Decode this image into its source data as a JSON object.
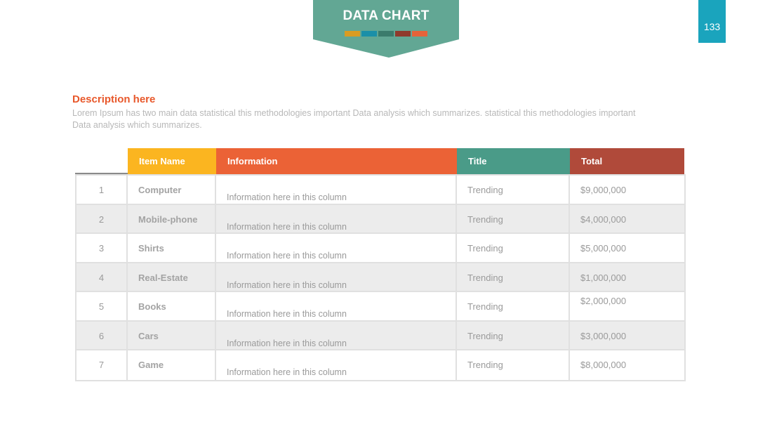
{
  "header": {
    "title": "DATA CHART",
    "ribbon_color": "#62a794",
    "swatch_colors": [
      "#d99c22",
      "#1b8fa8",
      "#3b7b6c",
      "#8f3a2c",
      "#e5633a"
    ]
  },
  "page_number": "133",
  "description": {
    "heading": "Description here",
    "text": "Lorem Ipsum has two main data statistical this methodologies important Data analysis which summarizes. statistical this methodologies important Data analysis which summarizes."
  },
  "table": {
    "columns": [
      {
        "label": "Item Name",
        "color": "#fbb520"
      },
      {
        "label": "Information",
        "color": "#eb6236"
      },
      {
        "label": "Title",
        "color": "#4a9b88"
      },
      {
        "label": "Total",
        "color": "#b04a3a"
      }
    ],
    "rows": [
      {
        "num": "1",
        "name": "Computer",
        "info": "Information here in this column",
        "title": "Trending",
        "total": "$9,000,000"
      },
      {
        "num": "2",
        "name": "Mobile-phone",
        "info": "Information here in this column",
        "title": "Trending",
        "total": "$4,000,000"
      },
      {
        "num": "3",
        "name": "Shirts",
        "info": "Information here in this column",
        "title": "Trending",
        "total": "$5,000,000"
      },
      {
        "num": "4",
        "name": "Real-Estate",
        "info": "Information here in this column",
        "title": "Trending",
        "total": "$1,000,000"
      },
      {
        "num": "5",
        "name": "Books",
        "info": "Information here in this column",
        "title": "Trending",
        "total": "$2,000,000"
      },
      {
        "num": "6",
        "name": "Cars",
        "info": "Information here in this column",
        "title": "Trending",
        "total": "$3,000,000"
      },
      {
        "num": "7",
        "name": "Game",
        "info": "Information here in this column",
        "title": "Trending",
        "total": "$8,000,000"
      }
    ]
  }
}
